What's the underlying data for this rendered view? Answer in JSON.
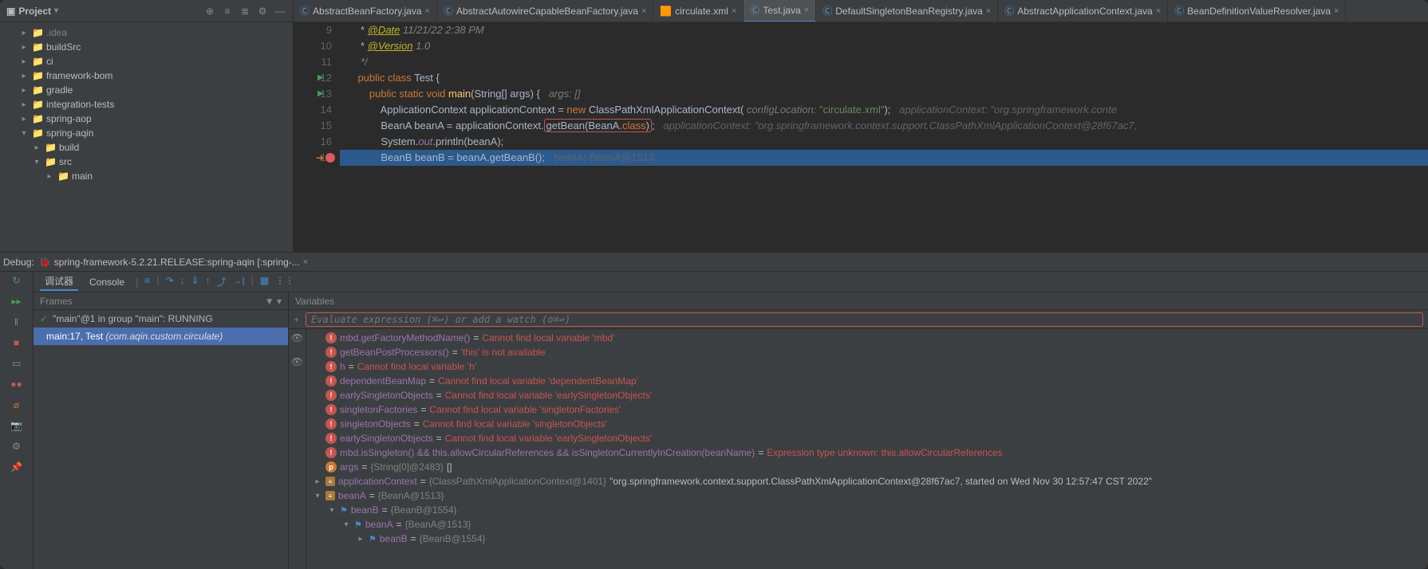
{
  "project": {
    "title": "Project",
    "tree": [
      {
        "indent": 1,
        "arrow": "▸",
        "icon": "folder",
        "label": ".idea",
        "dim": true
      },
      {
        "indent": 1,
        "arrow": "▸",
        "icon": "folder",
        "label": "buildSrc"
      },
      {
        "indent": 1,
        "arrow": "▸",
        "icon": "folder",
        "label": "ci"
      },
      {
        "indent": 1,
        "arrow": "▸",
        "icon": "folder",
        "label": "framework-bom"
      },
      {
        "indent": 1,
        "arrow": "▸",
        "icon": "folder",
        "label": "gradle"
      },
      {
        "indent": 1,
        "arrow": "▸",
        "icon": "folder",
        "label": "integration-tests"
      },
      {
        "indent": 1,
        "arrow": "▸",
        "icon": "folder",
        "label": "spring-aop"
      },
      {
        "indent": 1,
        "arrow": "▾",
        "icon": "folder",
        "label": "spring-aqin"
      },
      {
        "indent": 2,
        "arrow": "▸",
        "icon": "folder-orange",
        "label": "build"
      },
      {
        "indent": 2,
        "arrow": "▾",
        "icon": "folder",
        "label": "src"
      },
      {
        "indent": 3,
        "arrow": "▸",
        "icon": "folder",
        "label": "main"
      }
    ]
  },
  "tabs": [
    {
      "icon": "java",
      "label": "AbstractBeanFactory.java",
      "active": false
    },
    {
      "icon": "java",
      "label": "AbstractAutowireCapableBeanFactory.java",
      "active": false
    },
    {
      "icon": "xml",
      "label": "circulate.xml",
      "active": false
    },
    {
      "icon": "java",
      "label": "Test.java",
      "active": true
    },
    {
      "icon": "java",
      "label": "DefaultSingletonBeanRegistry.java",
      "active": false
    },
    {
      "icon": "java",
      "label": "AbstractApplicationContext.java",
      "active": false
    },
    {
      "icon": "java",
      "label": "BeanDefinitionValueResolver.java",
      "active": false
    }
  ],
  "code": {
    "lines": [
      {
        "n": 9,
        "html": "     * <span class='anno'>@Date</span> <span class='com'>11/21/22 2:38 PM</span>"
      },
      {
        "n": 10,
        "html": "     * <span class='anno'>@Version</span> <span class='com'>1.0</span>"
      },
      {
        "n": 11,
        "html": "     <span class='com'>*/</span>"
      },
      {
        "n": 12,
        "run": true,
        "html": "    <span class='kw'>public</span> <span class='kw'>class</span> <span class='type'>Test</span> {"
      },
      {
        "n": 13,
        "run": true,
        "html": "        <span class='kw'>public</span> <span class='kw'>static</span> <span class='kw'>void</span> <span class='method'>main</span>(<span class='type'>String</span>[] args) {   <span class='param-hint'>args: []</span>"
      },
      {
        "n": 14,
        "html": "            <span class='type'>ApplicationContext</span> applicationContext = <span class='kw'>new</span> <span class='type'>ClassPathXmlApplicationContext</span>( <span class='param-hint'>configLocation:</span> <span class='str'>\"circulate.xml\"</span>);   <span class='inline-hint'>applicationContext: \"org.springframework.conte</span>"
      },
      {
        "n": 15,
        "html": "            <span class='type'>BeanA</span> beanA = applicationContext.<span class='boxed'>getBean(<span class='type'>BeanA</span>.<span class='kw'>class</span>)</span>;   <span class='inline-hint'>applicationContext: \"org.springframework.context.support.ClassPathXmlApplicationContext@28f67ac7,</span>"
      },
      {
        "n": 16,
        "html": "            <span class='type'>System</span>.<span class='field'>out</span>.println(beanA);"
      },
      {
        "n": 17,
        "exec": true,
        "bp": true,
        "html": "            <span class='type'>BeanB</span> beanB = beanA.getBeanB();   <span class='inline-hint'>beanA: BeanA@1513</span>"
      }
    ]
  },
  "debug": {
    "label": "Debug:",
    "config": "spring-framework-5.2.21.RELEASE:spring-aqin [:spring-...",
    "tabs2": {
      "debugger": "调试器",
      "console": "Console"
    },
    "frames_hdr": "Frames",
    "vars_hdr": "Variables",
    "thread_line": "\"main\"@1 in group \"main\": RUNNING",
    "frame_a": "main:17, Test ",
    "frame_b": "(com.aqin.custom.circulate)",
    "eval_placeholder": "Evaluate expression (⌘↩) or add a watch (o⌘↩)",
    "vars": [
      {
        "indent": 1,
        "icon": "err",
        "name": "mbd.getFactoryMethodName()",
        "val": "Cannot find local variable 'mbd'",
        "err": true
      },
      {
        "indent": 1,
        "icon": "err",
        "name": "getBeanPostProcessors()",
        "val": "'this' is not available",
        "err": true
      },
      {
        "indent": 1,
        "icon": "err",
        "name": "h",
        "val": "Cannot find local variable 'h'",
        "err": true
      },
      {
        "indent": 1,
        "icon": "err",
        "name": "dependentBeanMap",
        "val": "Cannot find local variable 'dependentBeanMap'",
        "err": true
      },
      {
        "indent": 1,
        "icon": "err",
        "name": "earlySingletonObjects",
        "val": "Cannot find local variable 'earlySingletonObjects'",
        "err": true
      },
      {
        "indent": 1,
        "icon": "err",
        "name": "singletonFactories",
        "val": "Cannot find local variable 'singletonFactories'",
        "err": true
      },
      {
        "indent": 1,
        "icon": "err",
        "name": "singletonObjects",
        "val": "Cannot find local variable 'singletonObjects'",
        "err": true
      },
      {
        "indent": 1,
        "icon": "err",
        "name": "earlySingletonObjects",
        "val": "Cannot find local variable 'earlySingletonObjects'",
        "err": true
      },
      {
        "indent": 1,
        "icon": "err",
        "name": "mbd.isSingleton() && this.allowCircularReferences && isSingletonCurrentlyInCreation(beanName)",
        "val": "Expression type unknown: this.allowCircularReferences",
        "err": true
      },
      {
        "indent": 1,
        "icon": "p",
        "name": "args",
        "valdim": "{String[0]@2483}",
        "valstr": " []"
      },
      {
        "indent": 1,
        "arrow": "▸",
        "icon": "f",
        "name": "applicationContext",
        "valdim": "{ClassPathXmlApplicationContext@1401}",
        "valstr": " \"org.springframework.context.support.ClassPathXmlApplicationContext@28f67ac7, started on Wed Nov 30 12:57:47 CST 2022\""
      },
      {
        "indent": 1,
        "arrow": "▾",
        "icon": "f",
        "name": "beanA",
        "valdim": "{BeanA@1513}"
      },
      {
        "indent": 2,
        "arrow": "▾",
        "flag": true,
        "name": "beanB",
        "valdim": "{BeanB@1554}"
      },
      {
        "indent": 3,
        "arrow": "▾",
        "flag": true,
        "name": "beanA",
        "valdim": "{BeanA@1513}"
      },
      {
        "indent": 4,
        "arrow": "▸",
        "flag": true,
        "name": "beanB",
        "valdim": "{BeanB@1554}"
      }
    ]
  }
}
